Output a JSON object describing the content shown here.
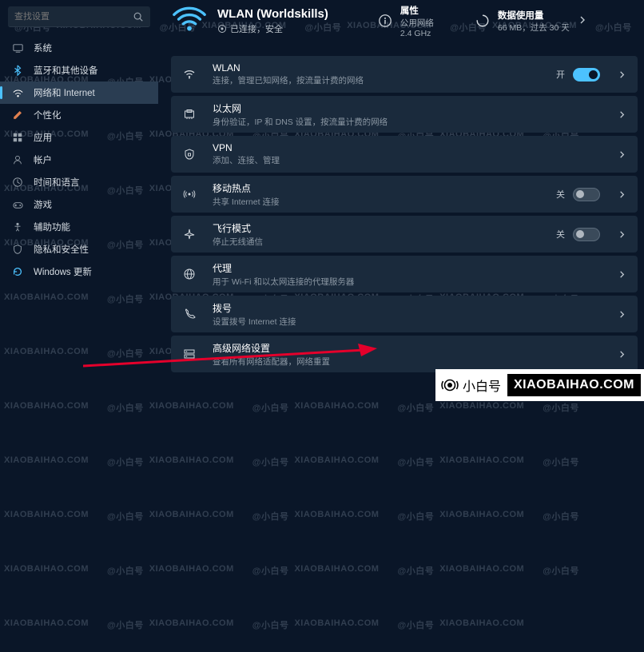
{
  "search": {
    "placeholder": "查找设置"
  },
  "sidebar": {
    "items": [
      {
        "label": "系统",
        "icon": "system-icon"
      },
      {
        "label": "蓝牙和其他设备",
        "icon": "bluetooth-icon"
      },
      {
        "label": "网络和 Internet",
        "icon": "network-icon"
      },
      {
        "label": "个性化",
        "icon": "personalization-icon"
      },
      {
        "label": "应用",
        "icon": "apps-icon"
      },
      {
        "label": "帐户",
        "icon": "accounts-icon"
      },
      {
        "label": "时间和语言",
        "icon": "time-language-icon"
      },
      {
        "label": "游戏",
        "icon": "gaming-icon"
      },
      {
        "label": "辅助功能",
        "icon": "accessibility-icon"
      },
      {
        "label": "隐私和安全性",
        "icon": "privacy-icon"
      },
      {
        "label": "Windows 更新",
        "icon": "windows-update-icon"
      }
    ],
    "active_index": 2
  },
  "hero": {
    "title": "WLAN (Worldskills)",
    "status_prefix": "⊕",
    "status_text": "已连接，安全",
    "tiles": [
      {
        "icon": "info-icon",
        "title": "属性",
        "sub1": "公用网络",
        "sub2": "2.4 GHz"
      },
      {
        "icon": "data-usage-icon",
        "title": "数据使用量",
        "sub1": "66 MB，过去 30 天",
        "sub2": ""
      }
    ]
  },
  "rows": [
    {
      "icon": "wifi-icon",
      "title": "WLAN",
      "sub": "连接，管理已知网络，按流量计费的网络",
      "ctrl": {
        "type": "toggle",
        "state": "on",
        "label": "开"
      }
    },
    {
      "icon": "ethernet-icon",
      "title": "以太网",
      "sub": "身份验证，IP 和 DNS 设置，按流量计费的网络",
      "ctrl": {
        "type": "chevron"
      }
    },
    {
      "icon": "vpn-icon",
      "title": "VPN",
      "sub": "添加、连接、管理",
      "ctrl": {
        "type": "chevron"
      }
    },
    {
      "icon": "hotspot-icon",
      "title": "移动热点",
      "sub": "共享 Internet 连接",
      "ctrl": {
        "type": "toggle",
        "state": "off",
        "label": "关"
      }
    },
    {
      "icon": "airplane-icon",
      "title": "飞行模式",
      "sub": "停止无线通信",
      "ctrl": {
        "type": "toggle",
        "state": "off",
        "label": "关"
      }
    },
    {
      "icon": "proxy-icon",
      "title": "代理",
      "sub": "用于 Wi-Fi 和以太网连接的代理服务器",
      "ctrl": {
        "type": "chevron"
      }
    },
    {
      "icon": "dialup-icon",
      "title": "拨号",
      "sub": "设置拨号 Internet 连接",
      "ctrl": {
        "type": "chevron"
      }
    },
    {
      "icon": "advanced-icon",
      "title": "高级网络设置",
      "sub": "查看所有网络适配器，网络重置",
      "ctrl": {
        "type": "chevron"
      }
    }
  ],
  "watermark": {
    "cn": "@小白号",
    "en": "XIAOBAIHAO.COM"
  },
  "badge": {
    "cn": "小白号",
    "en": "XIAOBAIHAO.COM"
  }
}
